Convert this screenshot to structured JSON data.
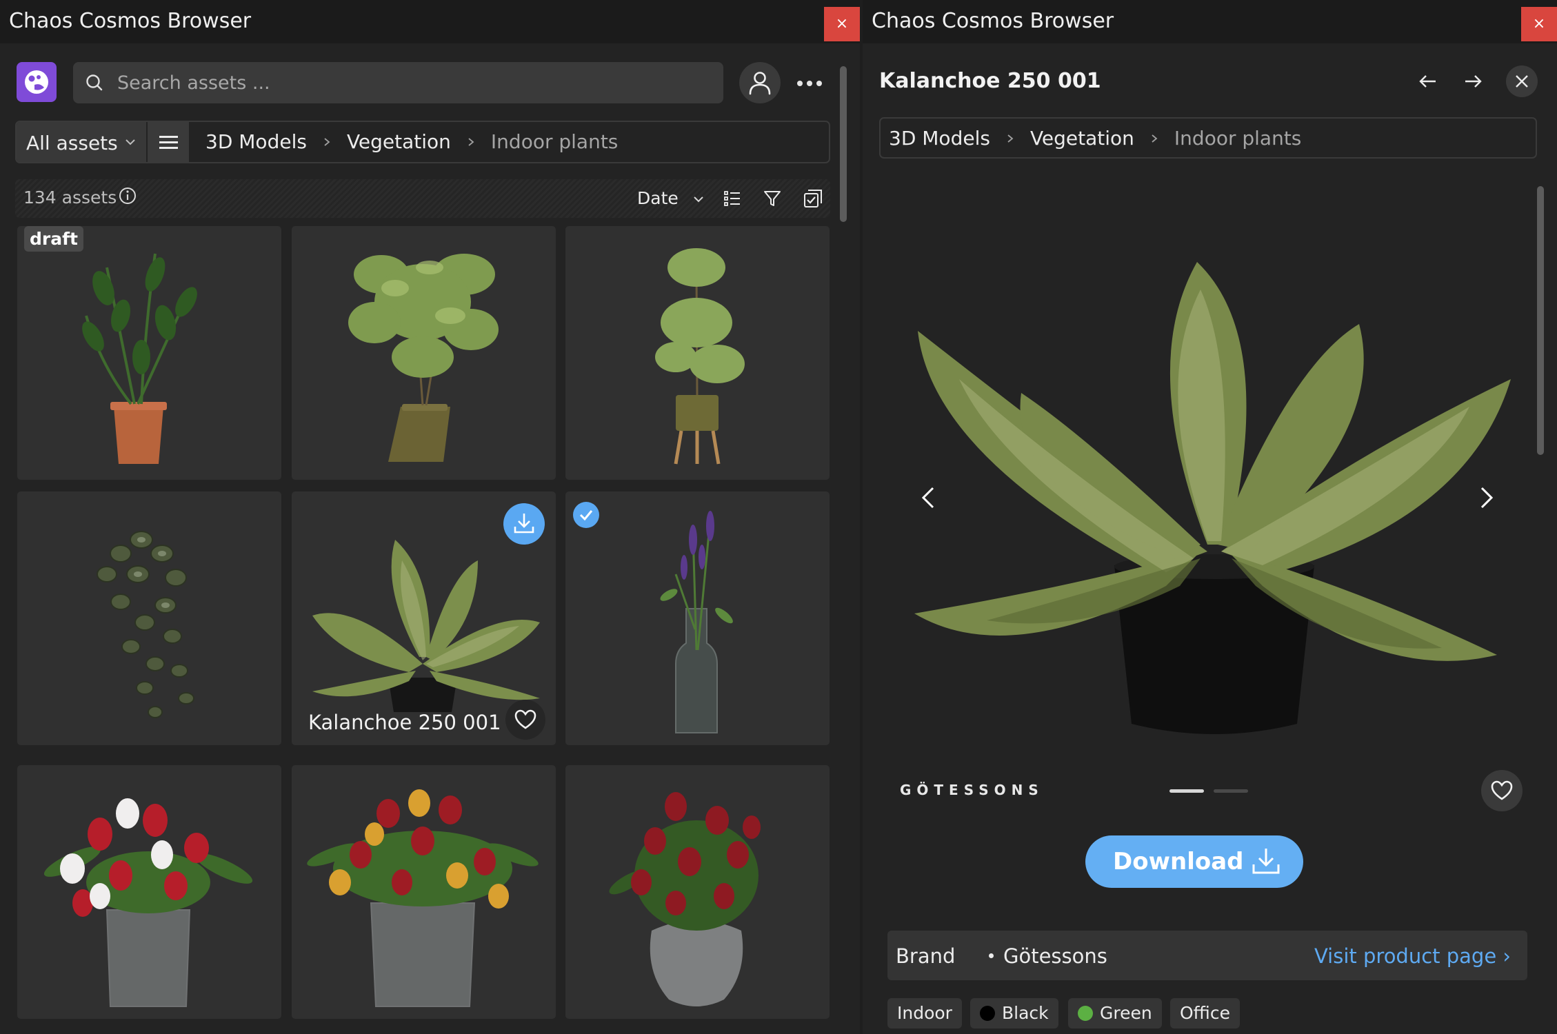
{
  "left_window": {
    "title": "Chaos Cosmos Browser",
    "close_label": "×",
    "search": {
      "placeholder": "Search assets ...",
      "value": ""
    },
    "nav": {
      "all_assets": "All assets",
      "breadcrumb": [
        "3D Models",
        "Vegetation",
        "Indoor plants"
      ]
    },
    "toolbar": {
      "count": "134 assets",
      "sort": "Date"
    },
    "tiles": [
      {
        "name": "",
        "badge": "draft",
        "icon": "zz-plant"
      },
      {
        "name": "",
        "icon": "bamboo-palm"
      },
      {
        "name": "",
        "icon": "tree-on-stand"
      },
      {
        "name": "",
        "icon": "hanging-peperomia"
      },
      {
        "name": "Kalanchoe 250 001",
        "icon": "kalanchoe",
        "hovered": true
      },
      {
        "name": "",
        "icon": "lavender-bottle",
        "selected": true
      },
      {
        "name": "",
        "icon": "red-white-tulips"
      },
      {
        "name": "",
        "icon": "mixed-tulips"
      },
      {
        "name": "",
        "icon": "red-tulips"
      }
    ]
  },
  "right_window": {
    "title": "Chaos Cosmos Browser",
    "close_label": "×",
    "asset_title": "Kalanchoe 250 001",
    "breadcrumb": [
      "3D Models",
      "Vegetation",
      "Indoor plants"
    ],
    "brand_logo": "GÖTESSONS",
    "download_label": "Download",
    "brand": {
      "label": "Brand",
      "value": "Götessons",
      "link": "Visit product page ›"
    },
    "tags": [
      {
        "label": "Indoor"
      },
      {
        "label": "Black",
        "color": "#000000"
      },
      {
        "label": "Green",
        "color": "#5cb043"
      },
      {
        "label": "Office"
      }
    ],
    "carousel": {
      "current": 1,
      "total": 2
    }
  },
  "colors": {
    "accent": "#5aa8f2",
    "close": "#d9463e",
    "logo": "#7f4bd8"
  }
}
